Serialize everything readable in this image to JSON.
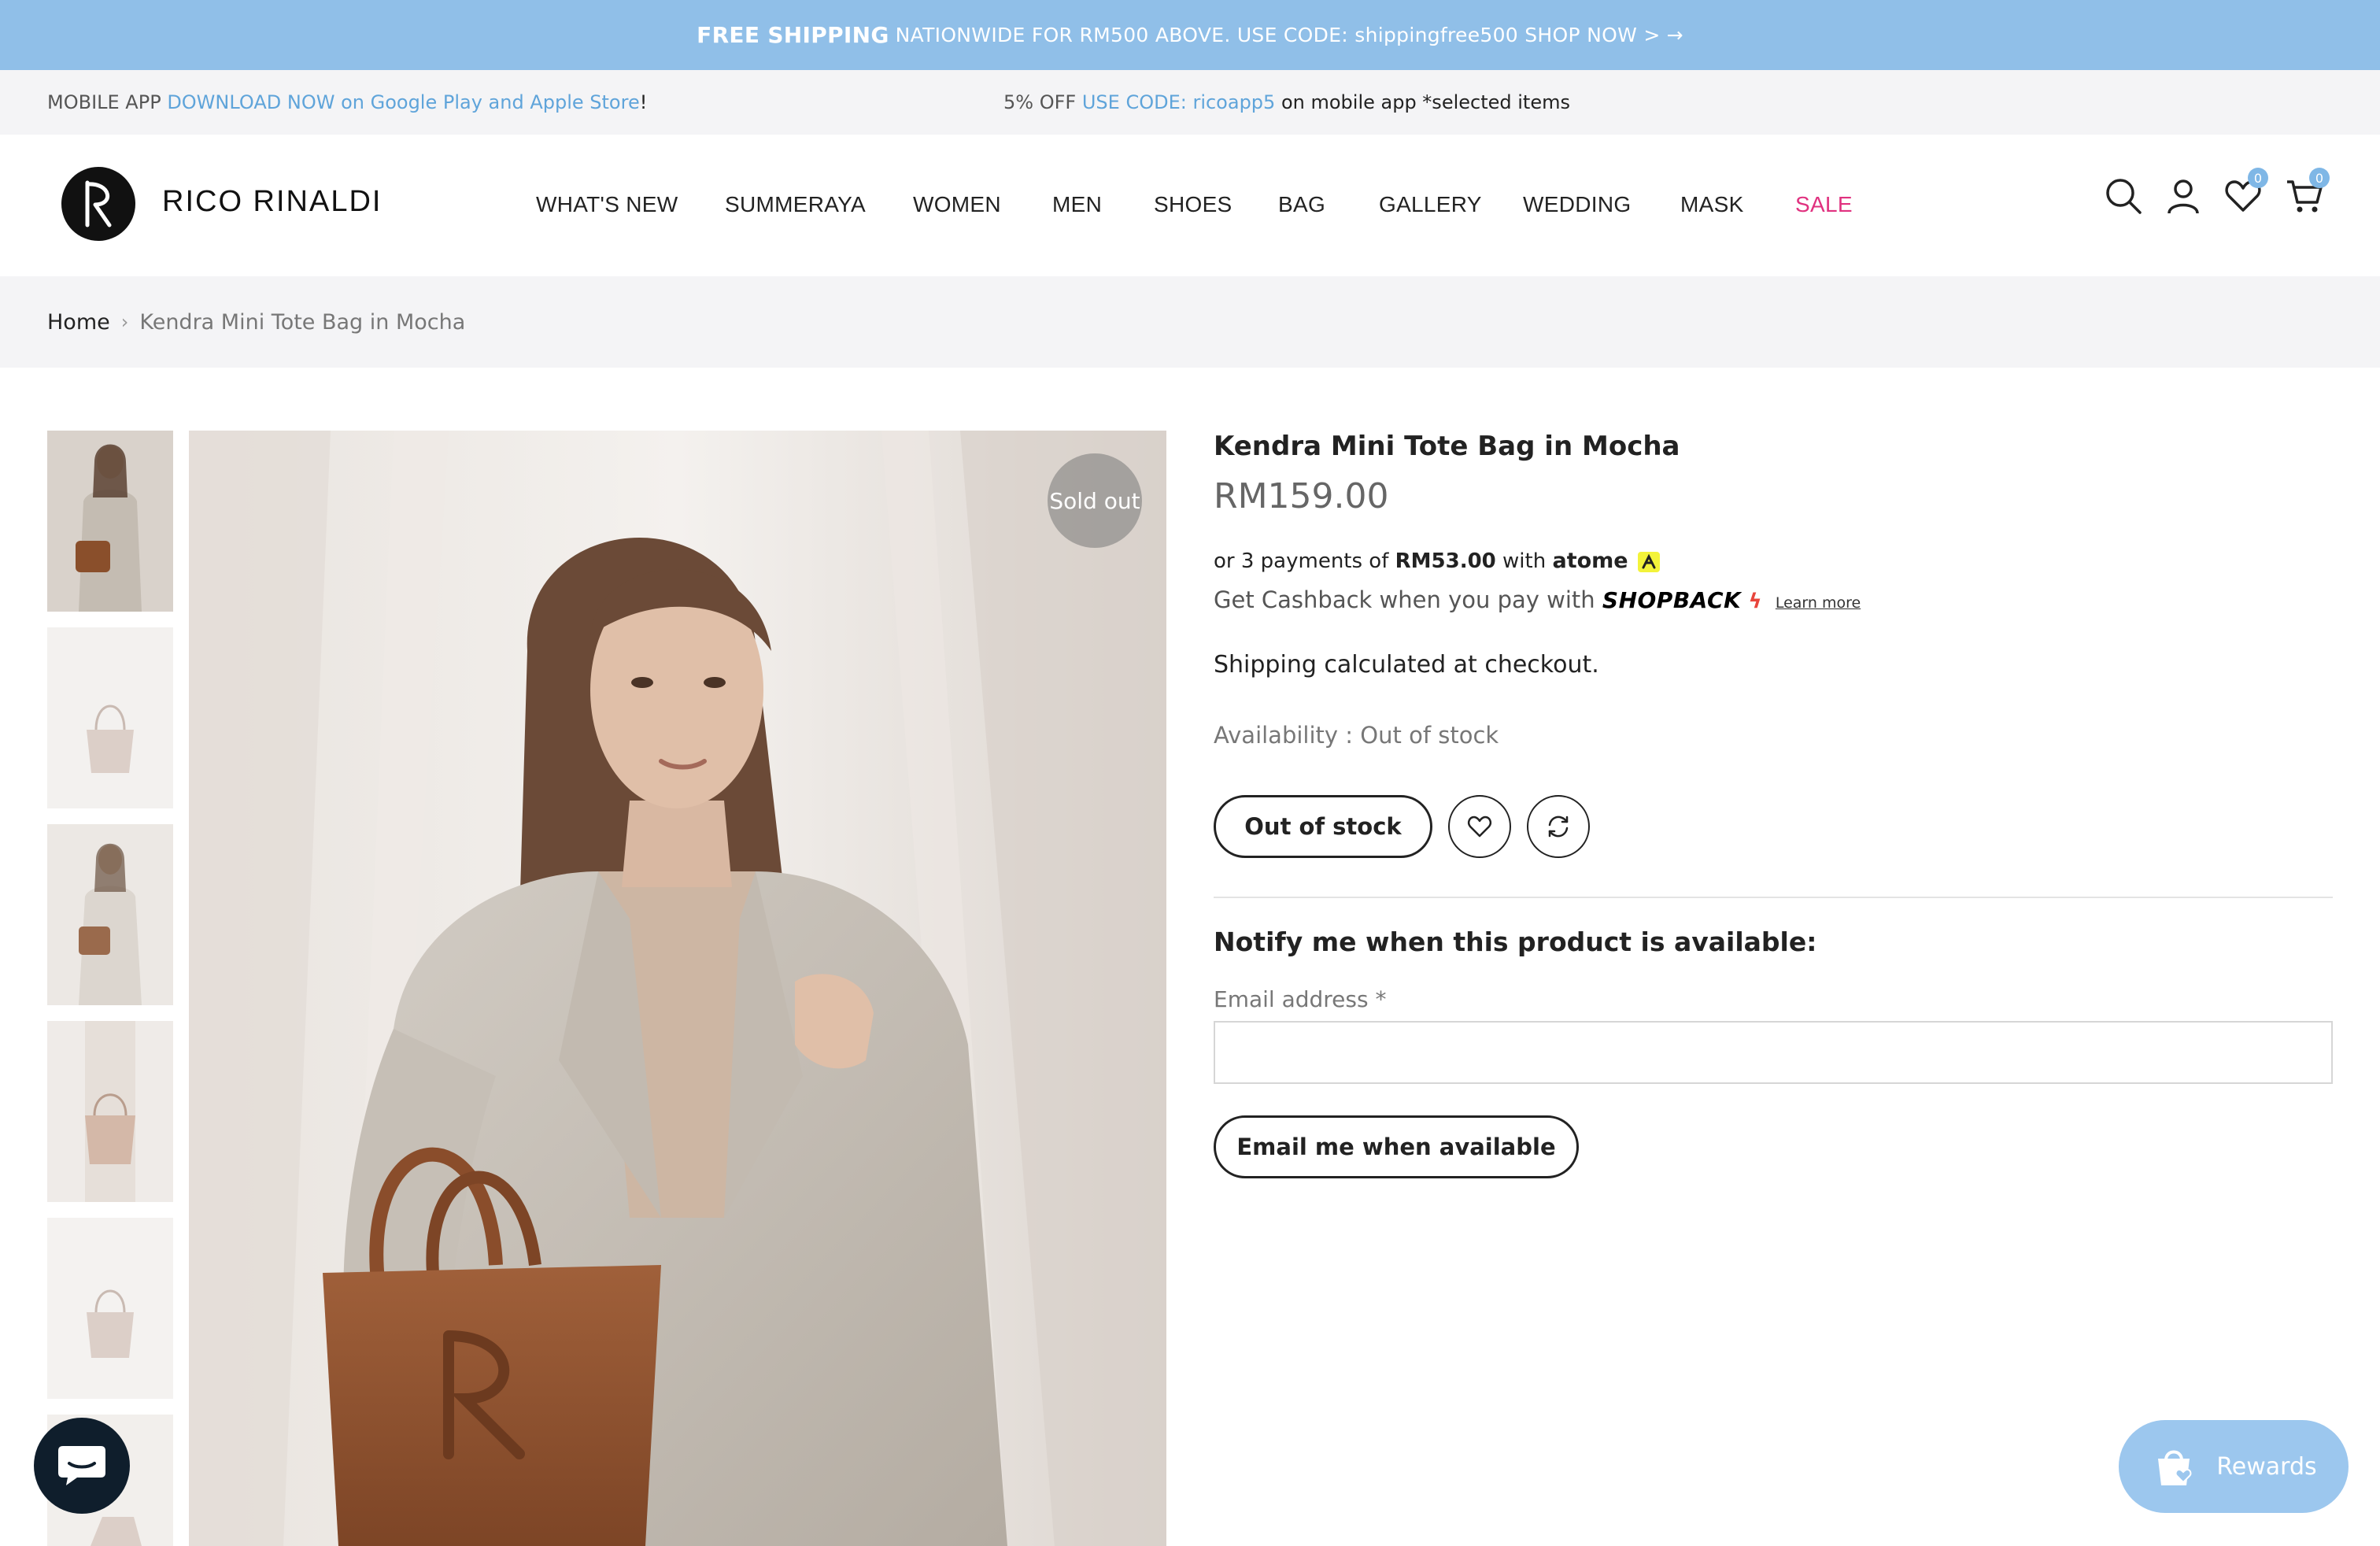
{
  "promo_bar": {
    "bold": "FREE SHIPPING",
    "text": "NATIONWIDE FOR RM500 ABOVE. USE CODE: shippingfree500 SHOP NOW >",
    "arrow": "→"
  },
  "announce": {
    "left_prefix": "MOBILE APP",
    "left_link": "DOWNLOAD NOW on Google Play and Apple Store",
    "left_suffix": "!",
    "center_prefix": "5% OFF",
    "center_link": "USE CODE: ricoapp5",
    "center_suffix": "on mobile app *selected items"
  },
  "header": {
    "brand": "RICO RINALDI",
    "nav": [
      "WHAT'S NEW",
      "SUMMERAYA",
      "WOMEN",
      "MEN",
      "SHOES",
      "BAG",
      "GALLERY",
      "WEDDING",
      "MASK",
      "SALE"
    ],
    "wishlist_count": "0",
    "cart_count": "0",
    "icons": [
      "search-icon",
      "account-icon",
      "heart-icon",
      "cart-icon"
    ]
  },
  "breadcrumb": {
    "home": "Home",
    "separator": "›",
    "current": "Kendra Mini Tote Bag in Mocha"
  },
  "gallery": {
    "badge": "Sold out",
    "thumbnail_count": 6
  },
  "product": {
    "title": "Kendra Mini Tote Bag in Mocha",
    "price": "RM159.00",
    "atome_prefix": "or 3 payments of",
    "atome_amount": "RM53.00",
    "atome_with": "with",
    "atome_brand": "atome",
    "shopback_text": "Get Cashback when you pay with",
    "shopback_brand": "SHOPBACK",
    "shopback_learn": "Learn more",
    "shipping": "Shipping calculated at checkout.",
    "availability": "Availability : Out of stock",
    "oos_button": "Out of stock",
    "notify_heading": "Notify me when this product is available:",
    "email_label": "Email address *",
    "email_value": "",
    "email_button": "Email me when available"
  },
  "widgets": {
    "rewards": "Rewards"
  },
  "colors": {
    "promo_bg": "#90bfe8",
    "link_blue": "#5fa4da",
    "sale_pink": "#e0317f",
    "rewards_bg": "#9cc7ee",
    "chat_bg": "#0f1e2c"
  }
}
